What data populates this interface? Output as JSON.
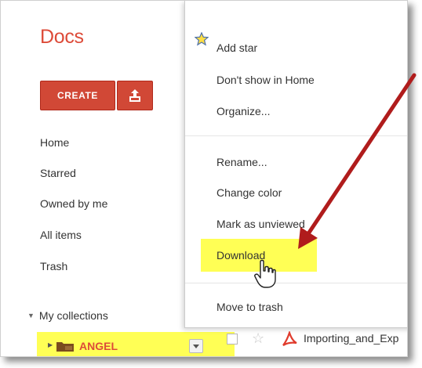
{
  "app": {
    "logo": "Docs"
  },
  "sidebar": {
    "create_label": "CREATE",
    "items": [
      {
        "label": "Home"
      },
      {
        "label": "Starred"
      },
      {
        "label": "Owned by me"
      },
      {
        "label": "All items"
      },
      {
        "label": "Trash"
      }
    ],
    "collections_label": "My collections",
    "selected_collection": "ANGEL"
  },
  "menu": {
    "items": [
      {
        "label": "Add star"
      },
      {
        "label": "Don't show in Home"
      },
      {
        "label": "Organize..."
      },
      {
        "label": "Rename..."
      },
      {
        "label": "Change color"
      },
      {
        "label": "Mark as unviewed"
      },
      {
        "label": "Download"
      },
      {
        "label": "Move to trash"
      }
    ]
  },
  "file_row": {
    "name": "Importing_and_Exp"
  },
  "colors": {
    "brand_red": "#dd4b39",
    "button_red": "#d14836",
    "highlight": "#ffff55",
    "arrow": "#b01c1c"
  },
  "icons": [
    "star-icon",
    "upload-icon",
    "folder-icon",
    "chevron-down-icon",
    "pdf-icon",
    "hand-cursor-icon",
    "arrow-annotation"
  ]
}
